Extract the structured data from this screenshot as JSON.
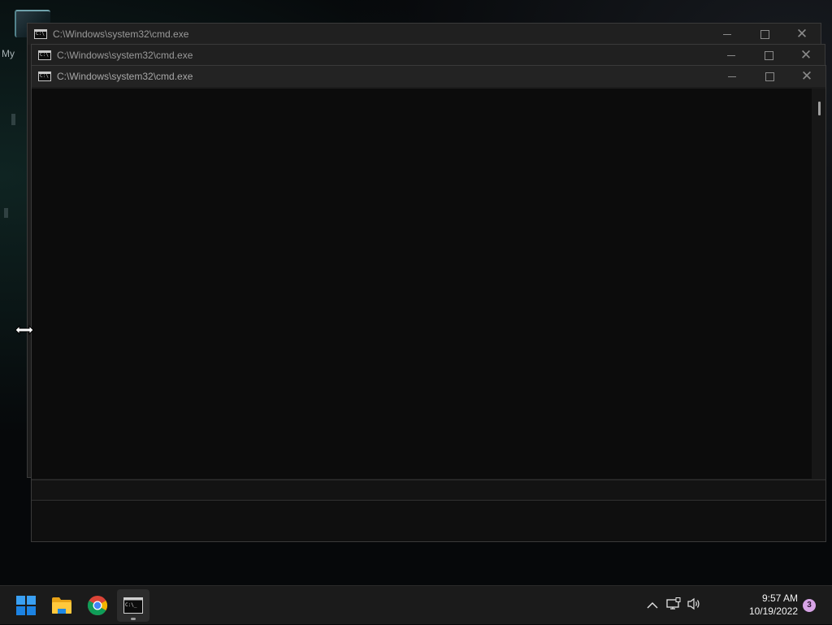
{
  "desktop": {
    "icon_label": "My"
  },
  "windows": [
    {
      "title": "C:\\Windows\\system32\\cmd.exe"
    },
    {
      "title": "C:\\Windows\\system32\\cmd.exe"
    },
    {
      "title": "C:\\Windows\\system32\\cmd.exe"
    }
  ],
  "window_controls": {
    "minimize": "minimize-icon",
    "maximize": "maximize-icon",
    "close": "close-icon"
  },
  "cursor": "resize-horizontal-cursor",
  "taskbar": {
    "apps": [
      {
        "name": "Start",
        "icon": "windows-start-icon"
      },
      {
        "name": "File Explorer",
        "icon": "folder-icon"
      },
      {
        "name": "Google Chrome",
        "icon": "chrome-icon"
      },
      {
        "name": "Command Prompt",
        "icon": "cmd-icon",
        "running": true
      }
    ],
    "tray": {
      "chevron": "^",
      "time": "9:57 AM",
      "date": "10/19/2022",
      "notification_count": "3"
    }
  },
  "colors": {
    "console_bg": "#0c0c0c",
    "titlebar_bg": "#202020",
    "taskbar_bg": "#1b1b1b",
    "accent": "#0078d4",
    "notification_badge": "#d7a3e6"
  }
}
